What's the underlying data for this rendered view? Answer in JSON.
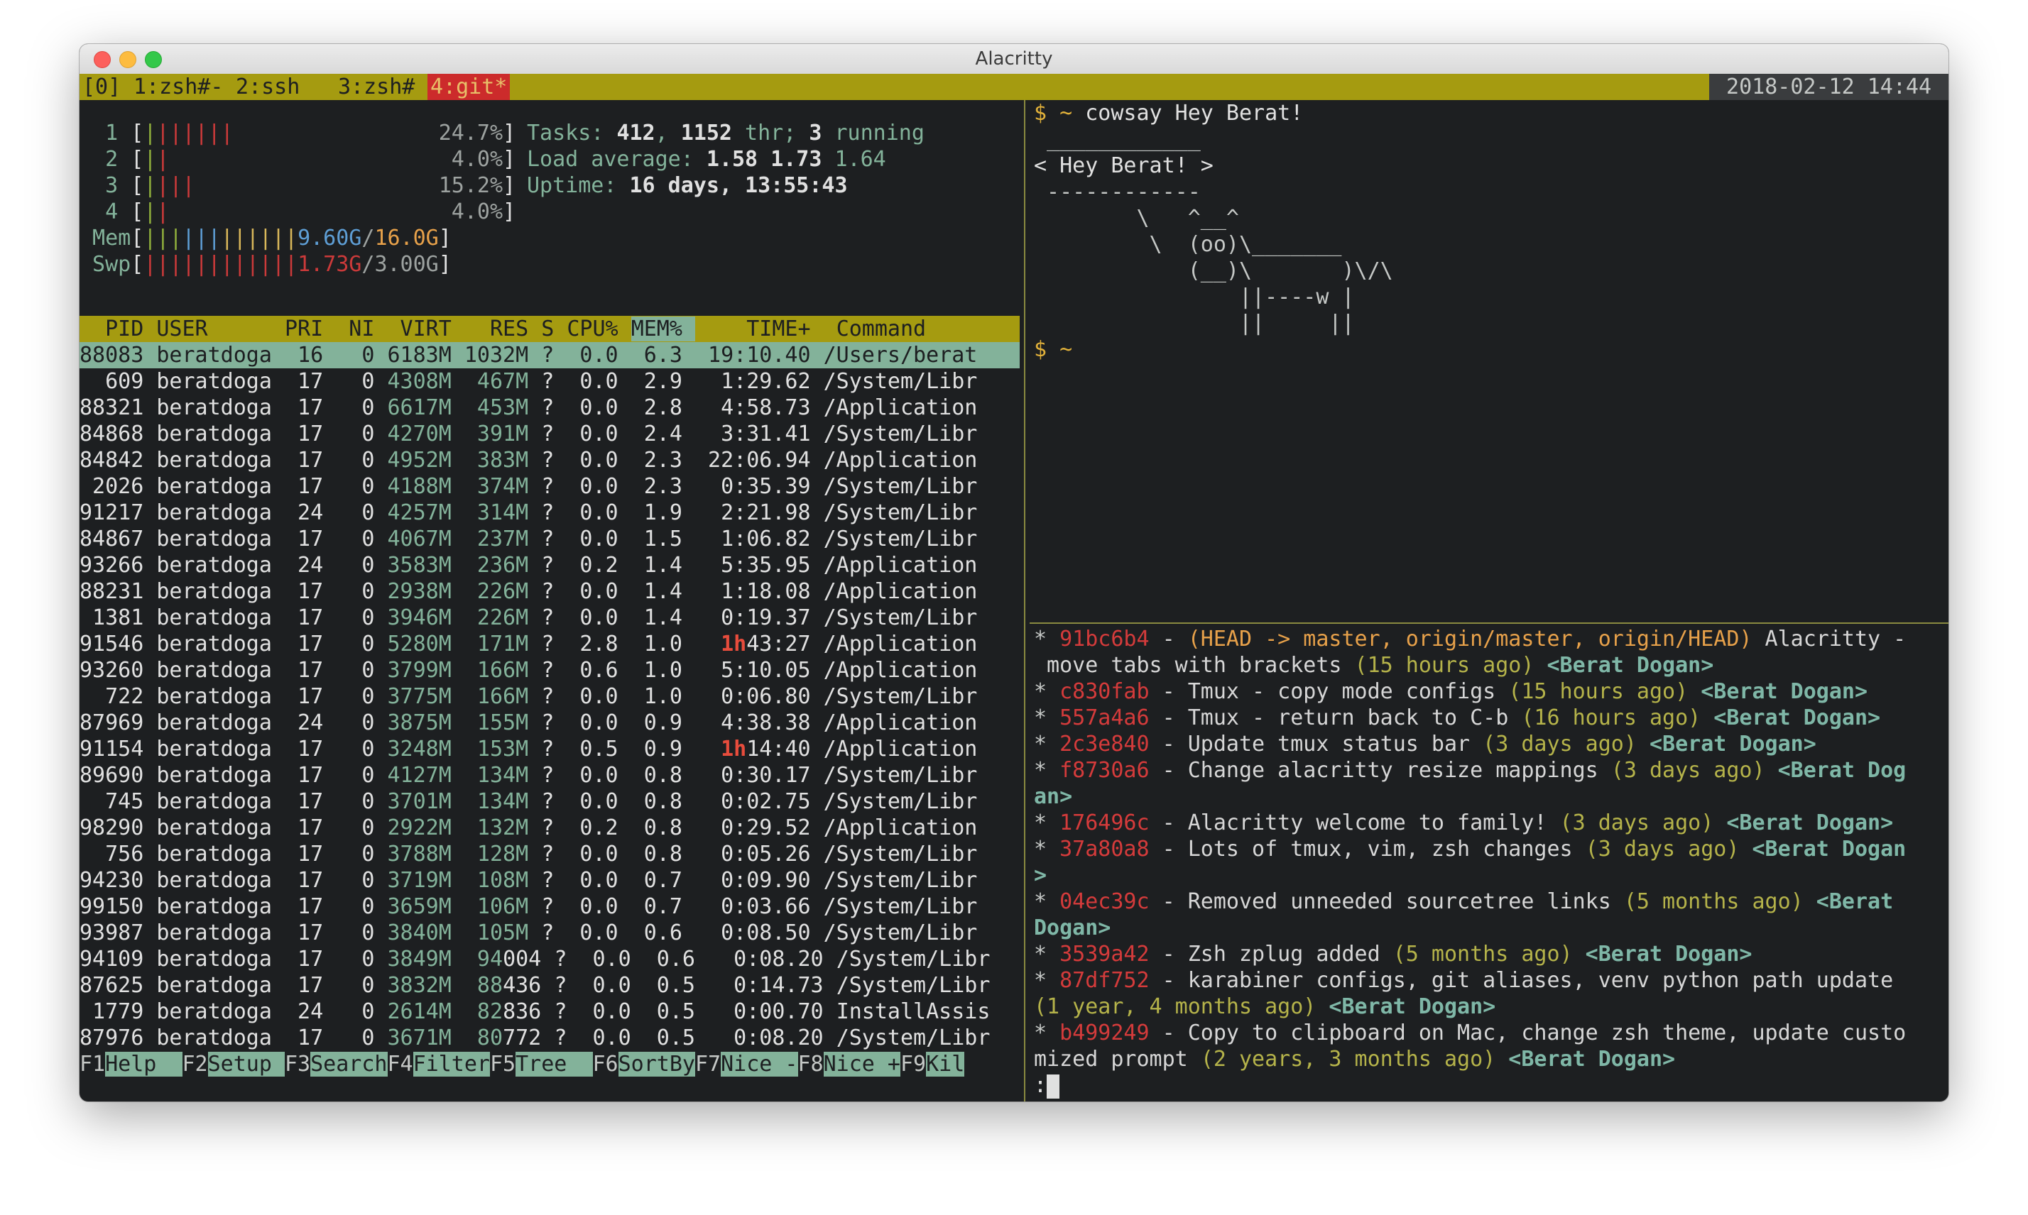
{
  "window": {
    "title": "Alacritty"
  },
  "tmux": {
    "session": "[0]",
    "tabs": [
      {
        "label": "1:zsh#-",
        "active": false
      },
      {
        "label": "2:ssh",
        "active": false
      },
      {
        "label": "3:zsh#",
        "active": false
      },
      {
        "label": "4:git*",
        "active": true
      }
    ],
    "clock": "2018-02-12 14:44"
  },
  "htop": {
    "cpus": [
      {
        "num": "1",
        "bar": "|||||||",
        "pct": "24.7%"
      },
      {
        "num": "2",
        "bar": "||",
        "pct": "4.0%"
      },
      {
        "num": "3",
        "bar": "||||",
        "pct": "15.2%"
      },
      {
        "num": "4",
        "bar": "||",
        "pct": "4.0%"
      }
    ],
    "mem": {
      "label": "Mem",
      "bar": "||||||||||||",
      "used": "9.60G",
      "total": "16.0G"
    },
    "swp": {
      "label": "Swp",
      "bar": "||||||||||||",
      "used": "1.73G",
      "total": "3.00G"
    },
    "tasks": {
      "label": "Tasks:",
      "count": "412",
      "thr": "1152",
      "thr_label": "thr;",
      "running": "3",
      "running_label": "running"
    },
    "load": {
      "label": "Load average:",
      "v1": "1.58",
      "v2": "1.73",
      "v3": "1.64"
    },
    "uptime": {
      "label": "Uptime:",
      "value": "16 days, 13:55:43"
    },
    "columns": [
      "PID",
      "USER",
      "PRI",
      "NI",
      "VIRT",
      "RES",
      "S",
      "CPU%",
      "MEM%",
      "TIME+",
      "Command"
    ],
    "processes": [
      {
        "pid": "88083",
        "user": "beratdoga",
        "pri": "16",
        "ni": "0",
        "virt": "6183M",
        "res": "1032M",
        "s": "?",
        "cpu": "0.0",
        "mem": "6.3",
        "time": "19:10.40",
        "cmd": "/Users/berat",
        "sel": true
      },
      {
        "pid": "609",
        "user": "beratdoga",
        "pri": "17",
        "ni": "0",
        "virt": "4308M",
        "res": "467M",
        "s": "?",
        "cpu": "0.0",
        "mem": "2.9",
        "time": "1:29.62",
        "cmd": "/System/Libr"
      },
      {
        "pid": "88321",
        "user": "beratdoga",
        "pri": "17",
        "ni": "0",
        "virt": "6617M",
        "res": "453M",
        "s": "?",
        "cpu": "0.0",
        "mem": "2.8",
        "time": "4:58.73",
        "cmd": "/Application"
      },
      {
        "pid": "84868",
        "user": "beratdoga",
        "pri": "17",
        "ni": "0",
        "virt": "4270M",
        "res": "391M",
        "s": "?",
        "cpu": "0.0",
        "mem": "2.4",
        "time": "3:31.41",
        "cmd": "/System/Libr"
      },
      {
        "pid": "84842",
        "user": "beratdoga",
        "pri": "17",
        "ni": "0",
        "virt": "4952M",
        "res": "383M",
        "s": "?",
        "cpu": "0.0",
        "mem": "2.3",
        "time": "22:06.94",
        "cmd": "/Application"
      },
      {
        "pid": "2026",
        "user": "beratdoga",
        "pri": "17",
        "ni": "0",
        "virt": "4188M",
        "res": "374M",
        "s": "?",
        "cpu": "0.0",
        "mem": "2.3",
        "time": "0:35.39",
        "cmd": "/System/Libr"
      },
      {
        "pid": "91217",
        "user": "beratdoga",
        "pri": "24",
        "ni": "0",
        "virt": "4257M",
        "res": "314M",
        "s": "?",
        "cpu": "0.0",
        "mem": "1.9",
        "time": "2:21.98",
        "cmd": "/System/Libr"
      },
      {
        "pid": "84867",
        "user": "beratdoga",
        "pri": "17",
        "ni": "0",
        "virt": "4067M",
        "res": "237M",
        "s": "?",
        "cpu": "0.0",
        "mem": "1.5",
        "time": "1:06.82",
        "cmd": "/System/Libr"
      },
      {
        "pid": "93266",
        "user": "beratdoga",
        "pri": "24",
        "ni": "0",
        "virt": "3583M",
        "res": "236M",
        "s": "?",
        "cpu": "0.2",
        "mem": "1.4",
        "time": "5:35.95",
        "cmd": "/Application"
      },
      {
        "pid": "88231",
        "user": "beratdoga",
        "pri": "17",
        "ni": "0",
        "virt": "2938M",
        "res": "226M",
        "s": "?",
        "cpu": "0.0",
        "mem": "1.4",
        "time": "1:18.08",
        "cmd": "/Application"
      },
      {
        "pid": "1381",
        "user": "beratdoga",
        "pri": "17",
        "ni": "0",
        "virt": "3946M",
        "res": "226M",
        "s": "?",
        "cpu": "0.0",
        "mem": "1.4",
        "time": "0:19.37",
        "cmd": "/System/Libr"
      },
      {
        "pid": "91546",
        "user": "beratdoga",
        "pri": "17",
        "ni": "0",
        "virt": "5280M",
        "res": "171M",
        "s": "?",
        "cpu": "2.8",
        "mem": "1.0",
        "time_h": "1h",
        "time": "43:27",
        "cmd": "/Application"
      },
      {
        "pid": "93260",
        "user": "beratdoga",
        "pri": "17",
        "ni": "0",
        "virt": "3799M",
        "res": "166M",
        "s": "?",
        "cpu": "0.6",
        "mem": "1.0",
        "time": "5:10.05",
        "cmd": "/Application"
      },
      {
        "pid": "722",
        "user": "beratdoga",
        "pri": "17",
        "ni": "0",
        "virt": "3775M",
        "res": "166M",
        "s": "?",
        "cpu": "0.0",
        "mem": "1.0",
        "time": "0:06.80",
        "cmd": "/System/Libr"
      },
      {
        "pid": "87969",
        "user": "beratdoga",
        "pri": "24",
        "ni": "0",
        "virt": "3875M",
        "res": "155M",
        "s": "?",
        "cpu": "0.0",
        "mem": "0.9",
        "time": "4:38.38",
        "cmd": "/Application"
      },
      {
        "pid": "91154",
        "user": "beratdoga",
        "pri": "17",
        "ni": "0",
        "virt": "3248M",
        "res": "153M",
        "s": "?",
        "cpu": "0.5",
        "mem": "0.9",
        "time_h": "1h",
        "time": "14:40",
        "cmd": "/Application"
      },
      {
        "pid": "89690",
        "user": "beratdoga",
        "pri": "17",
        "ni": "0",
        "virt": "4127M",
        "res": "134M",
        "s": "?",
        "cpu": "0.0",
        "mem": "0.8",
        "time": "0:30.17",
        "cmd": "/System/Libr"
      },
      {
        "pid": "745",
        "user": "beratdoga",
        "pri": "17",
        "ni": "0",
        "virt": "3701M",
        "res": "134M",
        "s": "?",
        "cpu": "0.0",
        "mem": "0.8",
        "time": "0:02.75",
        "cmd": "/System/Libr"
      },
      {
        "pid": "98290",
        "user": "beratdoga",
        "pri": "17",
        "ni": "0",
        "virt": "2922M",
        "res": "132M",
        "s": "?",
        "cpu": "0.2",
        "mem": "0.8",
        "time": "0:29.52",
        "cmd": "/Application"
      },
      {
        "pid": "756",
        "user": "beratdoga",
        "pri": "17",
        "ni": "0",
        "virt": "3788M",
        "res": "128M",
        "s": "?",
        "cpu": "0.0",
        "mem": "0.8",
        "time": "0:05.26",
        "cmd": "/System/Libr"
      },
      {
        "pid": "94230",
        "user": "beratdoga",
        "pri": "17",
        "ni": "0",
        "virt": "3719M",
        "res": "108M",
        "s": "?",
        "cpu": "0.0",
        "mem": "0.7",
        "time": "0:09.90",
        "cmd": "/System/Libr"
      },
      {
        "pid": "99150",
        "user": "beratdoga",
        "pri": "17",
        "ni": "0",
        "virt": "3659M",
        "res": "106M",
        "s": "?",
        "cpu": "0.0",
        "mem": "0.7",
        "time": "0:03.66",
        "cmd": "/System/Libr"
      },
      {
        "pid": "93987",
        "user": "beratdoga",
        "pri": "17",
        "ni": "0",
        "virt": "3840M",
        "res": "105M",
        "s": "?",
        "cpu": "0.0",
        "mem": "0.6",
        "time": "0:08.50",
        "cmd": "/System/Libr"
      },
      {
        "pid": "94109",
        "user": "beratdoga",
        "pri": "17",
        "ni": "0",
        "virt": "3849M",
        "res_a": "94",
        "res": "004",
        "s": "?",
        "cpu": "0.0",
        "mem": "0.6",
        "time": "0:08.20",
        "cmd": "/System/Libr"
      },
      {
        "pid": "87625",
        "user": "beratdoga",
        "pri": "17",
        "ni": "0",
        "virt": "3832M",
        "res_a": "88",
        "res": "436",
        "s": "?",
        "cpu": "0.0",
        "mem": "0.5",
        "time": "0:14.73",
        "cmd": "/System/Libr"
      },
      {
        "pid": "1779",
        "user": "beratdoga",
        "pri": "24",
        "ni": "0",
        "virt": "2614M",
        "res_a": "82",
        "res": "836",
        "s": "?",
        "cpu": "0.0",
        "mem": "0.5",
        "time": "0:00.70",
        "cmd": "InstallAssis"
      },
      {
        "pid": "87976",
        "user": "beratdoga",
        "pri": "17",
        "ni": "0",
        "virt": "3671M",
        "res_a": "80",
        "res": "772",
        "s": "?",
        "cpu": "0.0",
        "mem": "0.5",
        "time": "0:08.20",
        "cmd": "/System/Libr"
      }
    ],
    "fkeys": [
      {
        "key": "F1",
        "label": "Help  "
      },
      {
        "key": "F2",
        "label": "Setup "
      },
      {
        "key": "F3",
        "label": "Search"
      },
      {
        "key": "F4",
        "label": "Filter"
      },
      {
        "key": "F5",
        "label": "Tree  "
      },
      {
        "key": "F6",
        "label": "SortBy"
      },
      {
        "key": "F7",
        "label": "Nice -"
      },
      {
        "key": "F8",
        "label": "Nice +"
      },
      {
        "key": "F9",
        "label": "Kil"
      }
    ]
  },
  "cowsay": {
    "prompt": "$ ~",
    "command": "cowsay Hey Berat!",
    "lines": [
      " ____________",
      "< Hey Berat! >",
      " ------------",
      "        \\   ^__^",
      "         \\  (oo)\\_______",
      "            (__)\\       )\\/\\",
      "                ||----w |",
      "                ||     ||"
    ],
    "prompt2": "$ ~"
  },
  "gitlog": {
    "lines": [
      [
        {
          "c": "star",
          "t": "* "
        },
        {
          "c": "hash",
          "t": "91bc6b4"
        },
        {
          "c": "msg",
          "t": " - "
        },
        {
          "c": "refs",
          "t": "(HEAD -> master, origin/master, origin/HEAD)"
        },
        {
          "c": "msg",
          "t": " Alacritty -"
        }
      ],
      [
        {
          "c": "msg",
          "t": " move tabs with brackets "
        },
        {
          "c": "age",
          "t": "(15 hours ago)"
        },
        {
          "c": "msg",
          "t": " "
        },
        {
          "c": "author",
          "t": "<Berat Dogan>"
        }
      ],
      [
        {
          "c": "star",
          "t": "* "
        },
        {
          "c": "hash",
          "t": "c830fab"
        },
        {
          "c": "msg",
          "t": " - Tmux - copy mode configs "
        },
        {
          "c": "age",
          "t": "(15 hours ago)"
        },
        {
          "c": "msg",
          "t": " "
        },
        {
          "c": "author",
          "t": "<Berat Dogan>"
        }
      ],
      [
        {
          "c": "star",
          "t": "* "
        },
        {
          "c": "hash",
          "t": "557a4a6"
        },
        {
          "c": "msg",
          "t": " - Tmux - return back to C-b "
        },
        {
          "c": "age",
          "t": "(16 hours ago)"
        },
        {
          "c": "msg",
          "t": " "
        },
        {
          "c": "author",
          "t": "<Berat Dogan>"
        }
      ],
      [
        {
          "c": "star",
          "t": "* "
        },
        {
          "c": "hash",
          "t": "2c3e840"
        },
        {
          "c": "msg",
          "t": " - Update tmux status bar "
        },
        {
          "c": "age",
          "t": "(3 days ago)"
        },
        {
          "c": "msg",
          "t": " "
        },
        {
          "c": "author",
          "t": "<Berat Dogan>"
        }
      ],
      [
        {
          "c": "star",
          "t": "* "
        },
        {
          "c": "hash",
          "t": "f8730a6"
        },
        {
          "c": "msg",
          "t": " - Change alacritty resize mappings "
        },
        {
          "c": "age",
          "t": "(3 days ago)"
        },
        {
          "c": "msg",
          "t": " "
        },
        {
          "c": "author",
          "t": "<Berat Dog"
        }
      ],
      [
        {
          "c": "author",
          "t": "an>"
        }
      ],
      [
        {
          "c": "star",
          "t": "* "
        },
        {
          "c": "hash",
          "t": "176496c"
        },
        {
          "c": "msg",
          "t": " - Alacritty welcome to family! "
        },
        {
          "c": "age",
          "t": "(3 days ago)"
        },
        {
          "c": "msg",
          "t": " "
        },
        {
          "c": "author",
          "t": "<Berat Dogan>"
        }
      ],
      [
        {
          "c": "star",
          "t": "* "
        },
        {
          "c": "hash",
          "t": "37a80a8"
        },
        {
          "c": "msg",
          "t": " - Lots of tmux, vim, zsh changes "
        },
        {
          "c": "age",
          "t": "(3 days ago)"
        },
        {
          "c": "msg",
          "t": " "
        },
        {
          "c": "author",
          "t": "<Berat Dogan"
        }
      ],
      [
        {
          "c": "author",
          "t": ">"
        }
      ],
      [
        {
          "c": "star",
          "t": "* "
        },
        {
          "c": "hash",
          "t": "04ec39c"
        },
        {
          "c": "msg",
          "t": " - Removed unneeded sourcetree links "
        },
        {
          "c": "age",
          "t": "(5 months ago)"
        },
        {
          "c": "msg",
          "t": " "
        },
        {
          "c": "author",
          "t": "<Berat"
        }
      ],
      [
        {
          "c": "author",
          "t": "Dogan>"
        }
      ],
      [
        {
          "c": "star",
          "t": "* "
        },
        {
          "c": "hash",
          "t": "3539a42"
        },
        {
          "c": "msg",
          "t": " - Zsh zplug added "
        },
        {
          "c": "age",
          "t": "(5 months ago)"
        },
        {
          "c": "msg",
          "t": " "
        },
        {
          "c": "author",
          "t": "<Berat Dogan>"
        }
      ],
      [
        {
          "c": "star",
          "t": "* "
        },
        {
          "c": "hash",
          "t": "87df752"
        },
        {
          "c": "msg",
          "t": " - karabiner configs, git aliases, venv python path update"
        }
      ],
      [
        {
          "c": "age",
          "t": "(1 year, 4 months ago)"
        },
        {
          "c": "msg",
          "t": " "
        },
        {
          "c": "author",
          "t": "<Berat Dogan>"
        }
      ],
      [
        {
          "c": "star",
          "t": "* "
        },
        {
          "c": "hash",
          "t": "b499249"
        },
        {
          "c": "msg",
          "t": " - Copy to clipboard on Mac, change zsh theme, update custo"
        }
      ],
      [
        {
          "c": "msg",
          "t": "mized prompt "
        },
        {
          "c": "age",
          "t": "(2 years, 3 months ago)"
        },
        {
          "c": "msg",
          "t": " "
        },
        {
          "c": "author",
          "t": "<Berat Dogan>"
        }
      ]
    ],
    "pager_prompt": ":"
  }
}
